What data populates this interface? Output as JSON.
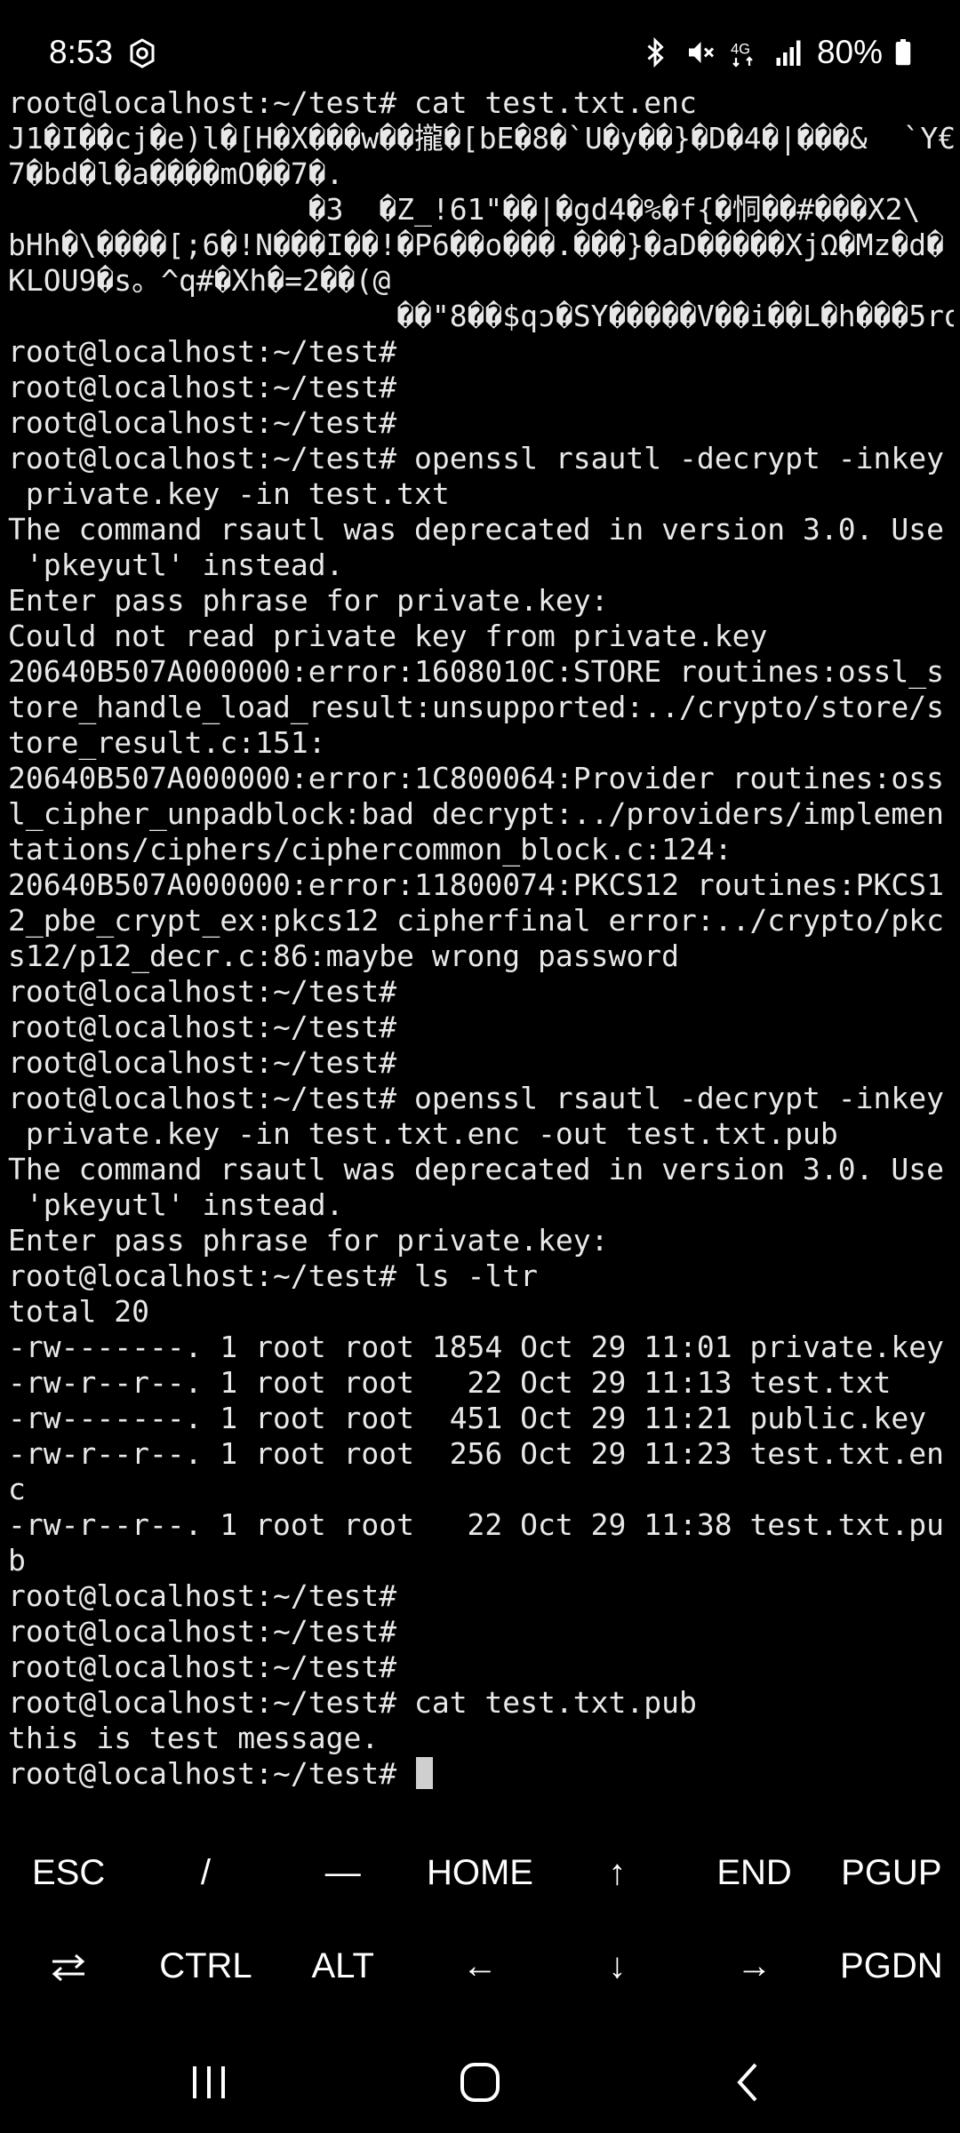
{
  "status_bar": {
    "time": "8:53",
    "battery": "80%",
    "icons": [
      "settings-gear-icon",
      "bluetooth-icon",
      "mute-icon",
      "4g-icon",
      "signal-icon",
      "battery-icon"
    ]
  },
  "terminal": {
    "lines": [
      "root@localhost:~/test# cat test.txt.enc",
      "J1�I��cj�e)l�[H�X���w��攏�[bE�8�`U�y��}�D�4�|���&  `Y€",
      "7�bd�l�a����mO��7�.",
      "                 �3  �Z_!61\"��|�gd4�%�f{�恫��#���X2\\",
      "bHh�\\����[;6�!N���I��!�P6��o���.���}�aD�����XjΩ�Mz�d�",
      "KLOU9�s。^q#�Xh�=2��(@",
      "                      ��\"8��$qɔ�SY�����V��i��L�h���5ro",
      "root@localhost:~/test#",
      "root@localhost:~/test#",
      "root@localhost:~/test#",
      "root@localhost:~/test# openssl rsautl -decrypt -inkey",
      " private.key -in test.txt",
      "The command rsautl was deprecated in version 3.0. Use",
      " 'pkeyutl' instead.",
      "Enter pass phrase for private.key:",
      "Could not read private key from private.key",
      "20640B507A000000:error:1608010C:STORE routines:ossl_s",
      "tore_handle_load_result:unsupported:../crypto/store/s",
      "tore_result.c:151:",
      "20640B507A000000:error:1C800064:Provider routines:oss",
      "l_cipher_unpadblock:bad decrypt:../providers/implemen",
      "tations/ciphers/ciphercommon_block.c:124:",
      "20640B507A000000:error:11800074:PKCS12 routines:PKCS1",
      "2_pbe_crypt_ex:pkcs12 cipherfinal error:../crypto/pkc",
      "s12/p12_decr.c:86:maybe wrong password",
      "root@localhost:~/test#",
      "root@localhost:~/test#",
      "root@localhost:~/test#",
      "root@localhost:~/test# openssl rsautl -decrypt -inkey",
      " private.key -in test.txt.enc -out test.txt.pub",
      "The command rsautl was deprecated in version 3.0. Use",
      " 'pkeyutl' instead.",
      "Enter pass phrase for private.key:",
      "root@localhost:~/test# ls -ltr",
      "total 20",
      "-rw-------. 1 root root 1854 Oct 29 11:01 private.key",
      "-rw-r--r--. 1 root root   22 Oct 29 11:13 test.txt",
      "-rw-------. 1 root root  451 Oct 29 11:21 public.key",
      "-rw-r--r--. 1 root root  256 Oct 29 11:23 test.txt.en",
      "c",
      "-rw-r--r--. 1 root root   22 Oct 29 11:38 test.txt.pu",
      "b",
      "root@localhost:~/test#",
      "root@localhost:~/test#",
      "root@localhost:~/test#",
      "root@localhost:~/test# cat test.txt.pub",
      "this is test message."
    ],
    "prompt": "root@localhost:~/test# "
  },
  "extra_keys": {
    "row1": [
      "ESC",
      "/",
      "—",
      "HOME",
      "↑",
      "END",
      "PGUP"
    ],
    "row2": [
      "CTRL",
      "ALT",
      "←",
      "↓",
      "→",
      "PGDN"
    ]
  },
  "nav_bar": {
    "icons": [
      "recent-apps-icon",
      "home-icon",
      "back-icon"
    ]
  }
}
